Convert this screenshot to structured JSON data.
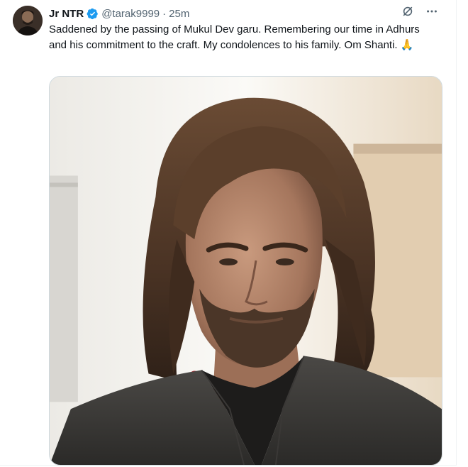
{
  "tweet": {
    "author_name": "Jr NTR",
    "handle": "@tarak9999",
    "separator": "·",
    "time": "25m",
    "text": "Saddened by the passing of Mukul Dev garu. Remembering our time in Adhurs and his commitment to the craft. My condolences to his family. Om Shanti. 🙏",
    "verified_color": "#1d9bf0"
  },
  "icons": {
    "grok": "grok-icon",
    "more": "more-icon",
    "verified": "verified-badge-icon"
  }
}
